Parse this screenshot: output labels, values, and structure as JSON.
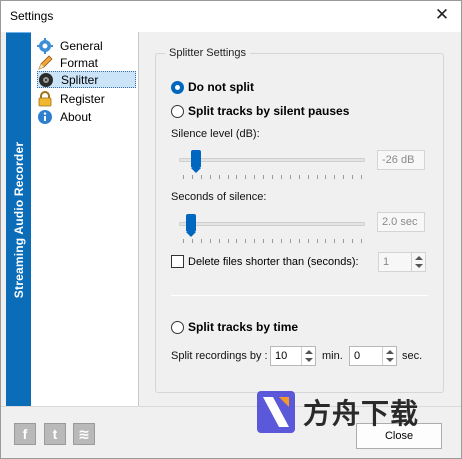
{
  "window": {
    "title": "Settings",
    "close_glyph": "✕"
  },
  "brand": {
    "text": "Streaming Audio Recorder",
    "color": "#0b6cb7"
  },
  "nav": {
    "items": [
      {
        "label": "General",
        "icon": "gear-icon"
      },
      {
        "label": "Format",
        "icon": "pencil-icon"
      },
      {
        "label": "Splitter",
        "icon": "splitter-disc-icon",
        "selected": true
      },
      {
        "label": "Register",
        "icon": "lock-icon"
      },
      {
        "label": "About",
        "icon": "info-icon"
      }
    ]
  },
  "splitter": {
    "group_title": "Splitter Settings",
    "mode_no_split": {
      "label": "Do not split",
      "checked": true
    },
    "mode_silent": {
      "label": "Split tracks by silent pauses",
      "checked": false
    },
    "silence_level": {
      "label": "Silence level (dB):",
      "value": "-26 dB",
      "slider_fraction": 0.07
    },
    "seconds_silence": {
      "label": "Seconds of silence:",
      "value": "2.0 sec",
      "slider_fraction": 0.04
    },
    "delete_shorter": {
      "label": "Delete files shorter than (seconds):",
      "checked": false,
      "value": "1"
    },
    "mode_time": {
      "label": "Split tracks by time",
      "checked": false
    },
    "split_by": {
      "label": "Split recordings by :",
      "minutes": "10",
      "min_label": "min.",
      "seconds": "0",
      "sec_label": "sec."
    }
  },
  "footer": {
    "social": [
      {
        "glyph": "f",
        "icon": "facebook-icon"
      },
      {
        "glyph": "t",
        "icon": "twitter-icon"
      },
      {
        "glyph": "≋",
        "icon": "rss-icon"
      }
    ],
    "close_label": "Close",
    "watermark_text": "方舟下载"
  },
  "colors": {
    "accent": "#0067c0",
    "selection": "#cce4f7"
  }
}
